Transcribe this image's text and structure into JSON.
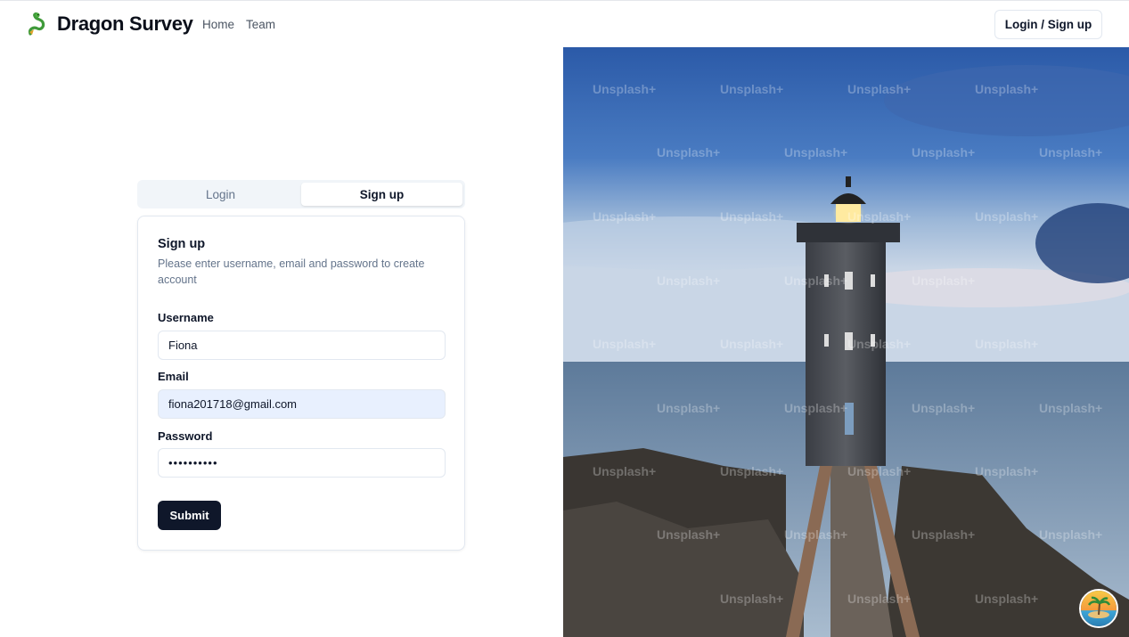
{
  "navbar": {
    "brand_name": "Dragon Survey",
    "brand_icon": "dragon-logo-icon",
    "links": [
      "Home",
      "Team"
    ],
    "login_signup_label": "Login / Sign up"
  },
  "auth": {
    "tabs": [
      "Login",
      "Sign up"
    ],
    "active_tab": "Sign up"
  },
  "signup_form": {
    "title": "Sign up",
    "description": "Please enter username, email and password to create account",
    "username_label": "Username",
    "username_value": "Fiona",
    "email_label": "Email",
    "email_value": "fiona201718@gmail.com",
    "password_label": "Password",
    "password_value": "••••••••••",
    "submit_label": "Submit"
  },
  "hero_image": {
    "subject": "lighthouse-on-rocky-coast",
    "watermark_text": "Unsplash+"
  },
  "colors": {
    "primary_button": "#0f172a",
    "autofill_field": "#e8f0fe",
    "muted_text": "#64748b",
    "border": "#e2e8f0"
  }
}
